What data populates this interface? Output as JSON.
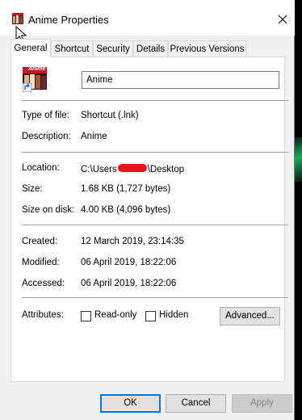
{
  "window": {
    "title": "Anime Properties",
    "close_glyph": "✕"
  },
  "tabs": [
    {
      "label": "General",
      "active": true
    },
    {
      "label": "Shortcut",
      "active": false
    },
    {
      "label": "Security",
      "active": false
    },
    {
      "label": "Details",
      "active": false
    },
    {
      "label": "Previous Versions",
      "active": false
    }
  ],
  "general": {
    "icon_text": "Anime",
    "name_value": "Anime",
    "type_label": "Type of file:",
    "type_value": "Shortcut (.lnk)",
    "description_label": "Description:",
    "description_value": "Anime",
    "location_label": "Location:",
    "location_prefix": "C:\\Users",
    "location_suffix": "\\Desktop",
    "size_label": "Size:",
    "size_value": "1.68 KB (1,727 bytes)",
    "size_on_disk_label": "Size on disk:",
    "size_on_disk_value": "4.00 KB (4,096 bytes)",
    "created_label": "Created:",
    "created_value": "12 March 2019, 23:14:35",
    "modified_label": "Modified:",
    "modified_value": "06 April 2019, 18:22:06",
    "accessed_label": "Accessed:",
    "accessed_value": "06 April 2019, 18:22:06",
    "attributes_label": "Attributes:",
    "readonly_label": "Read-only",
    "readonly_checked": false,
    "hidden_label": "Hidden",
    "hidden_checked": false,
    "advanced_label": "Advanced..."
  },
  "buttons": {
    "ok": "OK",
    "cancel": "Cancel",
    "apply": "Apply"
  },
  "colors": {
    "accent": "#0078d7",
    "redaction": "#e8141b"
  }
}
